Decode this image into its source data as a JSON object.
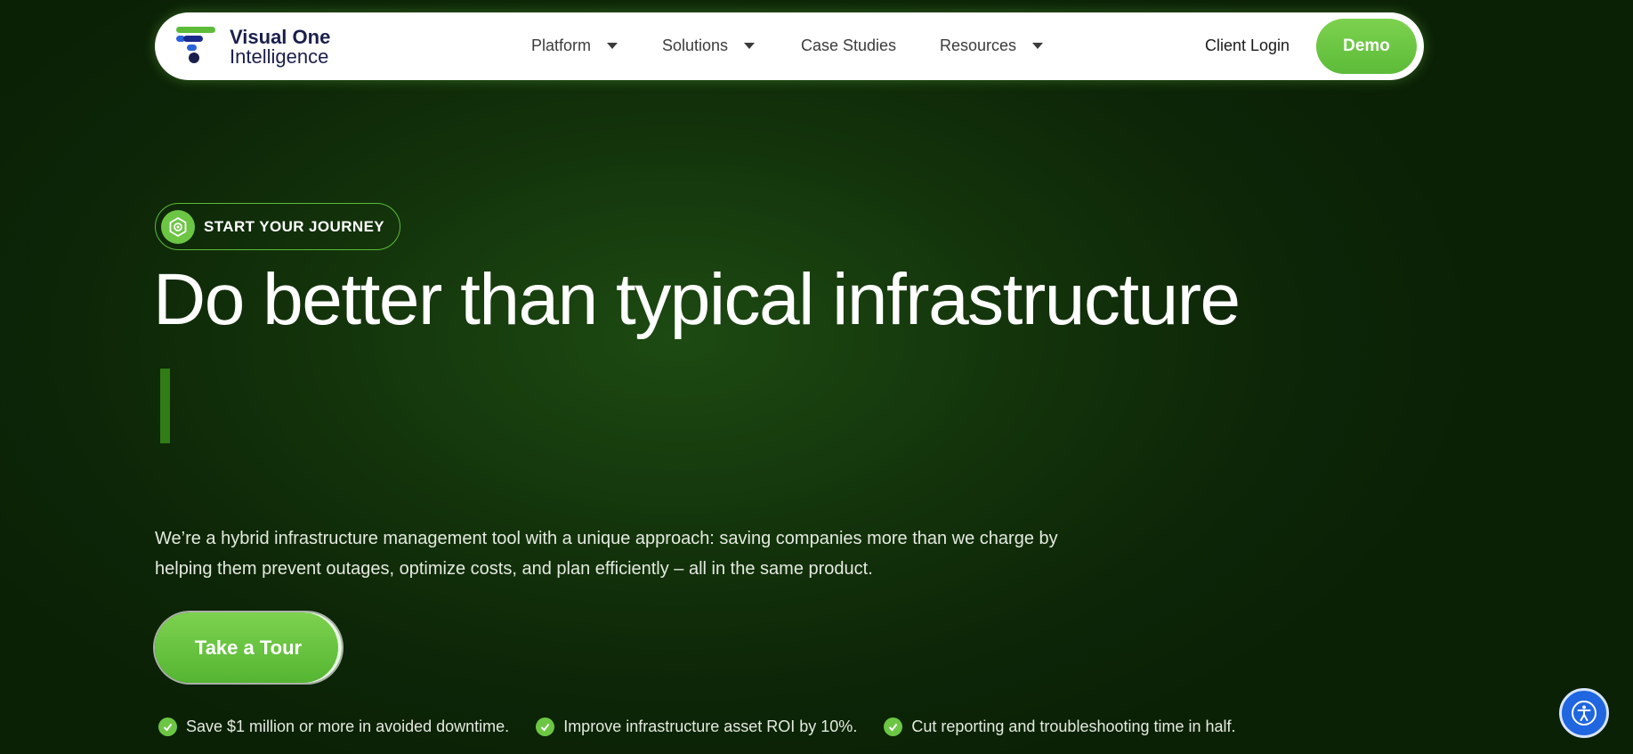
{
  "nav": {
    "logo": {
      "line1": "Visual One",
      "line2": "Intelligence"
    },
    "items": [
      {
        "label": "Platform",
        "has_dropdown": true
      },
      {
        "label": "Solutions",
        "has_dropdown": true
      },
      {
        "label": "Case Studies",
        "has_dropdown": false
      },
      {
        "label": "Resources",
        "has_dropdown": true
      }
    ],
    "client_login": "Client Login",
    "demo": "Demo"
  },
  "hero": {
    "badge": "START YOUR JOURNEY",
    "headline": "Do better than typical infrastructure",
    "description": "We’re a hybrid infrastructure management tool with a unique approach: saving companies more than we charge by helping them prevent outages, optimize costs, and plan efficiently – all in the same product.",
    "cta": "Take a Tour",
    "benefits": [
      "Save $1 million or more in avoided downtime.",
      "Improve infrastructure asset ROI by 10%.",
      "Cut reporting and troubleshooting time in half."
    ]
  },
  "colors": {
    "accent_green": "#6cc644",
    "background": "#13330b",
    "logo_navy": "#1a1f4b",
    "accessibility_blue": "#1f66e0"
  },
  "icons": {
    "badge": "gear-hexagon-icon",
    "benefit": "check-circle-icon",
    "accessibility": "accessibility-icon"
  }
}
